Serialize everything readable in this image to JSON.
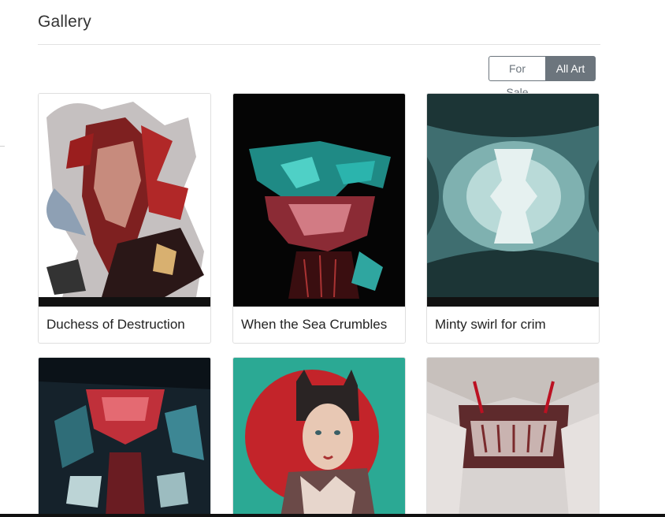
{
  "header": {
    "title": "Gallery"
  },
  "filters": {
    "for_sale": "For Sale",
    "all_art": "All Art",
    "active": "All Art"
  },
  "artworks": [
    {
      "title": "Duchess of Destruction"
    },
    {
      "title": "When the Sea Crumbles"
    },
    {
      "title": "Minty swirl for crim"
    },
    {
      "title": ""
    },
    {
      "title": ""
    },
    {
      "title": ""
    }
  ],
  "colors": {
    "accent": "#6c757d",
    "border": "#dfdfdf",
    "text": "#222222"
  }
}
